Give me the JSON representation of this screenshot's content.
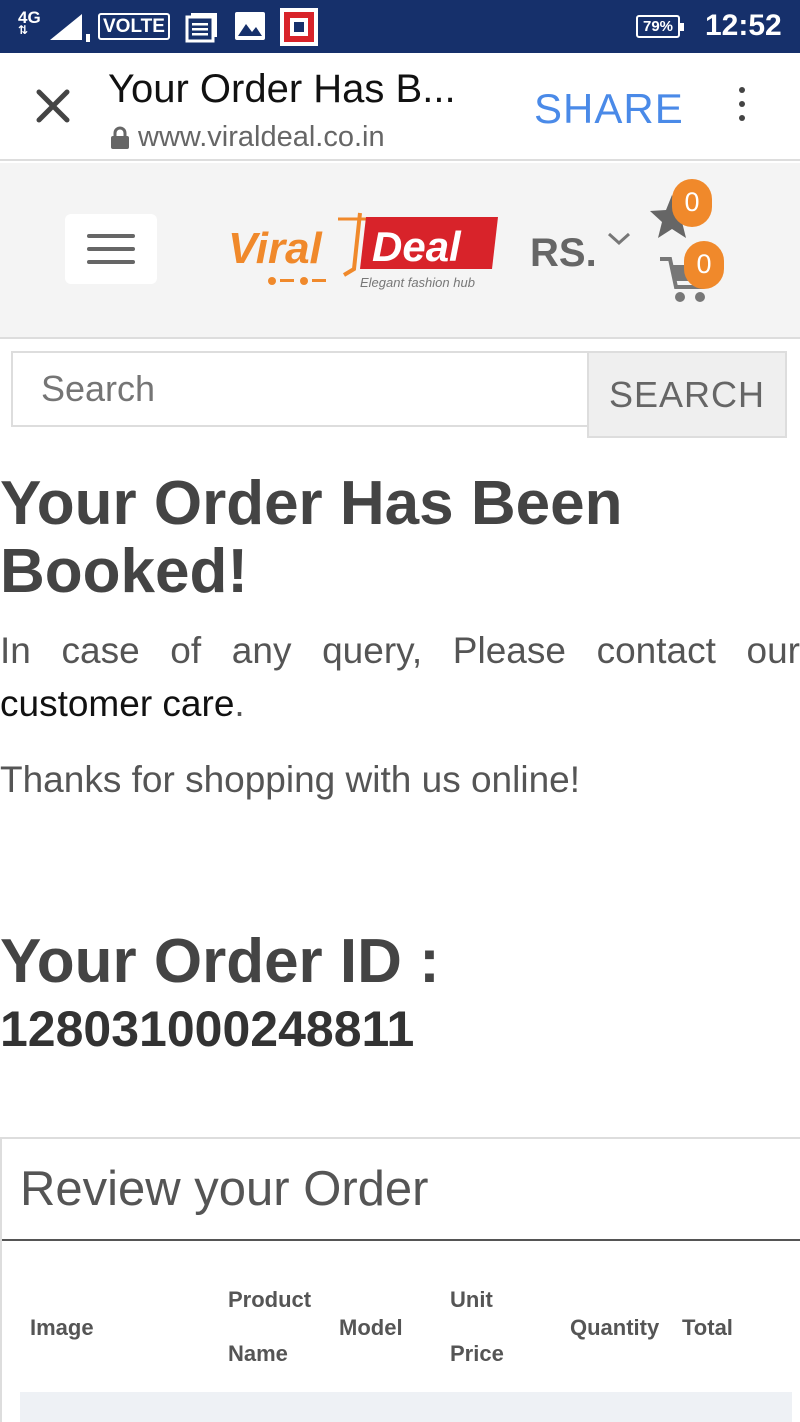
{
  "status_bar": {
    "network": "4G",
    "volte": "VOLTE",
    "battery": "79%",
    "time": "12:52"
  },
  "browser": {
    "title": "Your Order Has B...",
    "url": "www.viraldeal.co.in",
    "share_label": "SHARE"
  },
  "site": {
    "logo_word1": "Viral",
    "logo_word2": "Deal",
    "tagline": "Elegant fashion hub",
    "currency": "RS.",
    "wishlist_count": "0",
    "cart_count": "0",
    "colors": {
      "brand_orange": "#f0892b",
      "brand_red": "#d8232a",
      "status_bar": "#16306b",
      "link_blue": "#4a8ae8"
    }
  },
  "search": {
    "placeholder": "Search",
    "button_label": "SEARCH"
  },
  "main": {
    "heading": "Your Order Has Been Booked!",
    "query_text": "In case of any query, Please contact our",
    "customer_care_link": "customer care",
    "period": ".",
    "thanks_text": "Thanks for shopping with us online!",
    "order_id_label": "Your Order ID :",
    "order_id": "128031000248811"
  },
  "review": {
    "title": "Review your Order",
    "columns": [
      "Image",
      "Product Name",
      "Model",
      "Unit Price",
      "Quantity",
      "Total"
    ]
  }
}
